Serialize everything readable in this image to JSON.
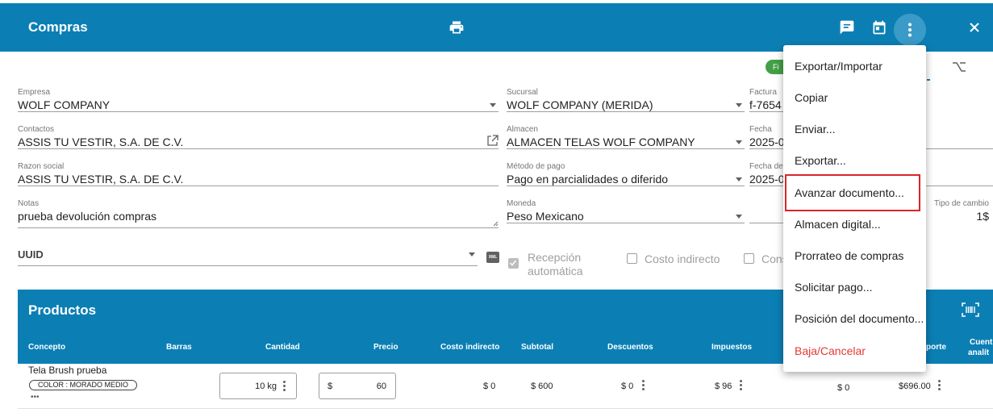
{
  "app": {
    "title": "Compras"
  },
  "status_badge": "Fi",
  "form": {
    "empresa": {
      "label": "Empresa",
      "value": "WOLF COMPANY"
    },
    "sucursal": {
      "label": "Sucursal",
      "value": "WOLF COMPANY (MERIDA)"
    },
    "factura": {
      "label": "Factura",
      "value": "f-7654"
    },
    "contactos": {
      "label": "Contactos",
      "value": "ASSIS TU VESTIR, S.A. DE C.V."
    },
    "almacen": {
      "label": "Almacen",
      "value": "ALMACEN TELAS WOLF COMPANY"
    },
    "fecha": {
      "label": "Fecha",
      "value": "2025-0"
    },
    "razon_social": {
      "label": "Razon social",
      "value": "ASSIS TU VESTIR, S.A. DE C.V."
    },
    "metodo_pago": {
      "label": "Método de pago",
      "value": "Pago en parcialidades o diferido"
    },
    "fecha_de": {
      "label": "Fecha de",
      "value": "2025-0"
    },
    "notas": {
      "label": "Notas",
      "value": "prueba devolución compras"
    },
    "moneda": {
      "label": "Moneda",
      "value": "Peso Mexicano"
    },
    "tipo_cambio": {
      "label": "Tipo de cambio",
      "value": "1$"
    },
    "uuid": {
      "label": "UUID"
    },
    "xml_label": "XML",
    "recepcion": {
      "label1": "Recepción",
      "label2": "automática",
      "checked": true
    },
    "costo_indirecto": "Costo indirecto",
    "cons": "Cons"
  },
  "productos": {
    "title": "Productos",
    "headers": {
      "concepto": "Concepto",
      "barras": "Barras",
      "cantidad": "Cantidad",
      "precio": "Precio",
      "costo_indirecto": "Costo indirecto",
      "subtotal": "Subtotal",
      "descuentos": "Descuentos",
      "impuestos": "Impuestos",
      "importe": "porte",
      "cuenta1": "Cuent",
      "cuenta2": "analít"
    },
    "row": {
      "concepto": "Tela Brush prueba",
      "chip": "COLOR : MORADO MEDIO",
      "more": "•••",
      "cantidad": "10 kg",
      "precio_symbol": "$",
      "precio": "60",
      "costo_indirecto": "$ 0",
      "subtotal": "$ 600",
      "descuentos": "$ 0",
      "impuestos": "$ 96",
      "col9": "$ 0",
      "importe": "$696.00"
    }
  },
  "menu": {
    "items": [
      {
        "label": "Exportar/Importar"
      },
      {
        "label": "Copiar"
      },
      {
        "label": "Enviar..."
      },
      {
        "label": "Exportar..."
      },
      {
        "label": "Avanzar documento..."
      },
      {
        "label": "Almacen digital..."
      },
      {
        "label": "Prorrateo de compras"
      },
      {
        "label": "Solicitar pago..."
      },
      {
        "label": "Posición del documento..."
      },
      {
        "label": "Baja/Cancelar"
      }
    ]
  },
  "colors": {
    "primary": "#0b7fb4",
    "danger": "#e53935",
    "highlight": "#d9262b",
    "status": "#43a047"
  }
}
